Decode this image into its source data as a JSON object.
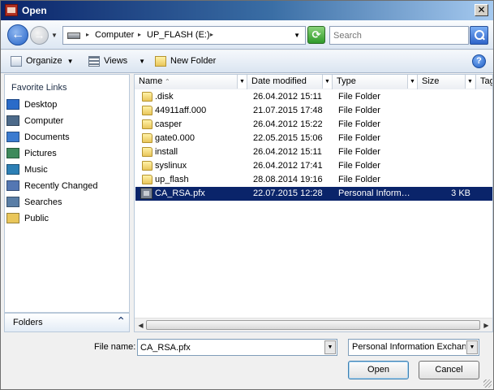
{
  "window": {
    "title": "Open",
    "close_glyph": "✕"
  },
  "navigation": {
    "back_glyph": "←",
    "forward_glyph": "→",
    "breadcrumb": [
      "Computer",
      "UP_FLASH (E:)"
    ],
    "refresh_glyph": "⟳",
    "search_placeholder": "Search"
  },
  "toolbar": {
    "organize_label": "Organize",
    "views_label": "Views",
    "new_folder_label": "New Folder",
    "help_glyph": "?"
  },
  "sidebar": {
    "heading": "Favorite Links",
    "items": [
      {
        "label": "Desktop",
        "icon": "desktop-icon",
        "color": "#2a6bc9"
      },
      {
        "label": "Computer",
        "icon": "computer-icon",
        "color": "#4c6a8a"
      },
      {
        "label": "Documents",
        "icon": "documents-icon",
        "color": "#3b7bd0"
      },
      {
        "label": "Pictures",
        "icon": "pictures-icon",
        "color": "#3e8a5c"
      },
      {
        "label": "Music",
        "icon": "music-icon",
        "color": "#2c7fb5"
      },
      {
        "label": "Recently Changed",
        "icon": "recent-icon",
        "color": "#5477b3"
      },
      {
        "label": "Searches",
        "icon": "searches-icon",
        "color": "#5a7ea6"
      },
      {
        "label": "Public",
        "icon": "folder-icon",
        "color": "#e9c65a"
      }
    ],
    "folders_label": "Folders"
  },
  "file_list": {
    "columns": [
      "Name",
      "Date modified",
      "Type",
      "Size",
      "Tags"
    ],
    "rows": [
      {
        "name": ".disk",
        "date": "26.04.2012 15:11",
        "type": "File Folder",
        "size": "",
        "kind": "folder"
      },
      {
        "name": "44911aff.000",
        "date": "21.07.2015 17:48",
        "type": "File Folder",
        "size": "",
        "kind": "folder"
      },
      {
        "name": "casper",
        "date": "26.04.2012 15:22",
        "type": "File Folder",
        "size": "",
        "kind": "folder"
      },
      {
        "name": "gate0.000",
        "date": "22.05.2015 15:06",
        "type": "File Folder",
        "size": "",
        "kind": "folder"
      },
      {
        "name": "install",
        "date": "26.04.2012 15:11",
        "type": "File Folder",
        "size": "",
        "kind": "folder"
      },
      {
        "name": "syslinux",
        "date": "26.04.2012 17:41",
        "type": "File Folder",
        "size": "",
        "kind": "folder"
      },
      {
        "name": "up_flash",
        "date": "28.08.2014 19:16",
        "type": "File Folder",
        "size": "",
        "kind": "folder"
      },
      {
        "name": "CA_RSA.pfx",
        "date": "22.07.2015 12:28",
        "type": "Personal Inform…",
        "size": "3 KB",
        "kind": "pfx",
        "selected": true
      }
    ]
  },
  "bottom": {
    "file_name_label": "File name:",
    "file_name_value": "CA_RSA.pfx",
    "file_type_value": "Personal Information Exchange",
    "open_label": "Open",
    "cancel_label": "Cancel"
  },
  "colors": {
    "selection": "#0a246a",
    "title_start": "#0a246a",
    "title_end": "#a6caf0"
  }
}
